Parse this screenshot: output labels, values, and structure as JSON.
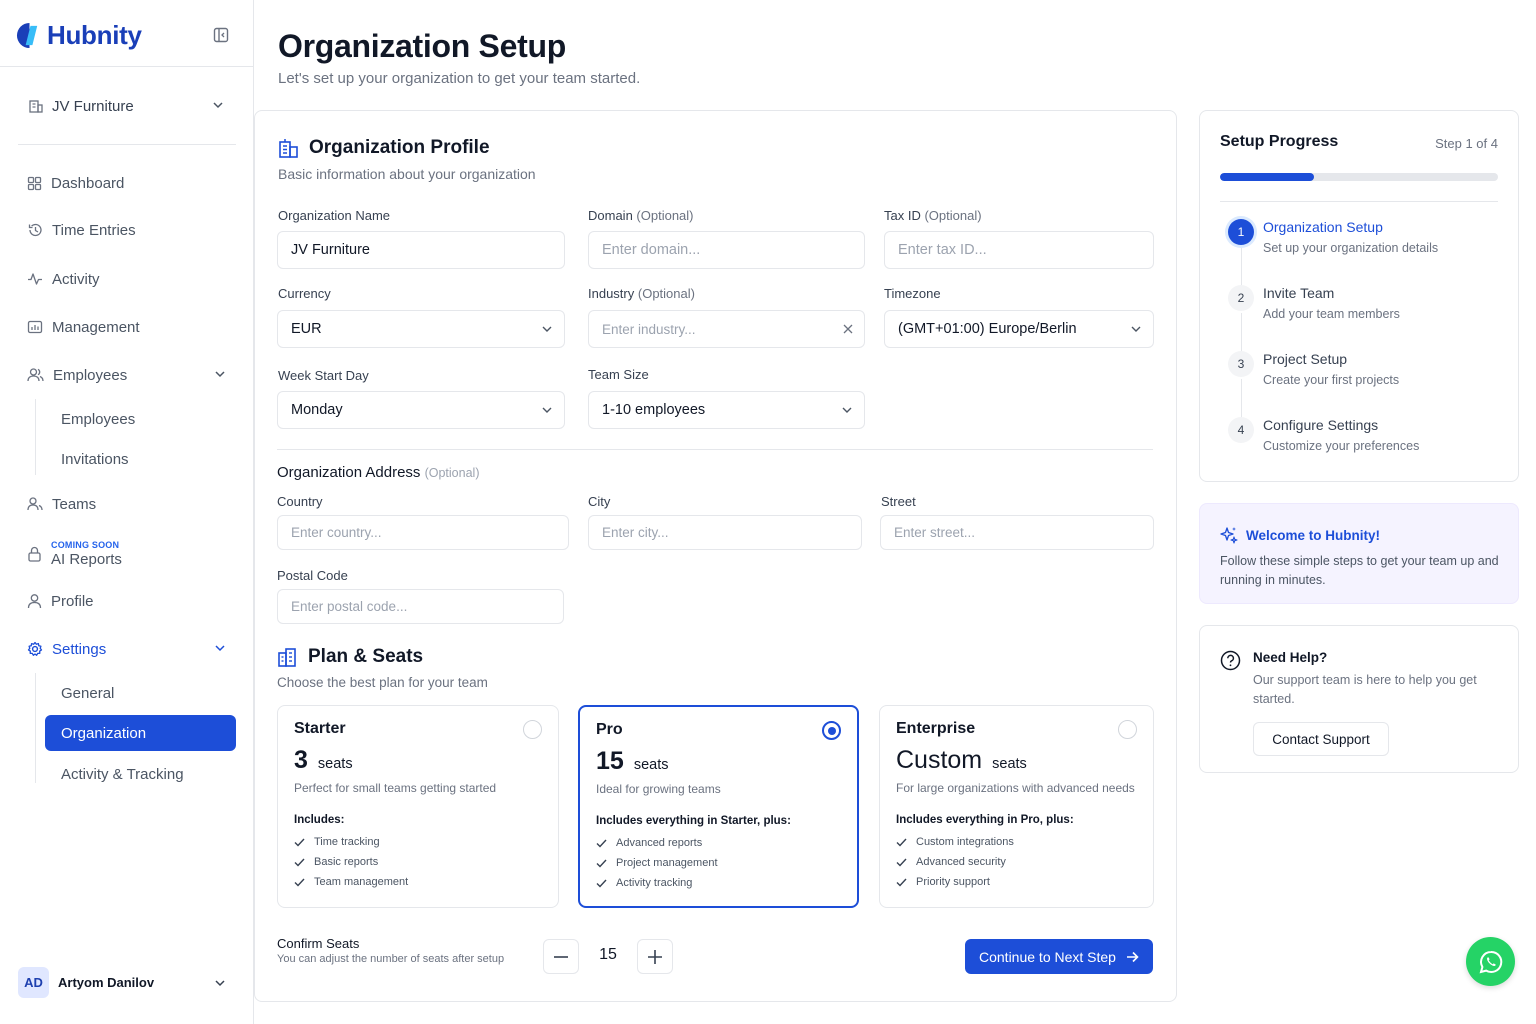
{
  "colors": {
    "primary": "#1d4ed8",
    "whatsapp": "#25d366"
  },
  "brand": {
    "name": "Hubnity",
    "logo_icon": "hubnity-logo-icon"
  },
  "sidebar": {
    "org_switcher": "JV Furniture",
    "items": {
      "dashboard": "Dashboard",
      "time_entries": "Time Entries",
      "activity": "Activity",
      "management": "Management",
      "employees": "Employees",
      "teams": "Teams",
      "ai_reports_badge": "COMING SOON",
      "ai_reports": "AI Reports",
      "profile": "Profile",
      "settings": "Settings"
    },
    "employees_sub": {
      "employees": "Employees",
      "invitations": "Invitations"
    },
    "settings_sub": {
      "general": "General",
      "organization": "Organization",
      "activity_tracking": "Activity & Tracking"
    },
    "user": {
      "initials": "AD",
      "name": "Artyom Danilov"
    }
  },
  "header": {
    "title": "Organization Setup",
    "subtitle": "Let's set up your organization to get your team started."
  },
  "profile": {
    "title": "Organization Profile",
    "subtitle": "Basic information about your organization",
    "org_name_label": "Organization Name",
    "org_name_value": "JV Furniture",
    "domain_label": "Domain",
    "optional": "(Optional)",
    "domain_placeholder": "Enter domain...",
    "tax_label": "Tax ID",
    "tax_placeholder": "Enter tax ID...",
    "currency_label": "Currency",
    "currency_value": "EUR",
    "industry_label": "Industry",
    "industry_placeholder": "Enter industry...",
    "timezone_label": "Timezone",
    "timezone_value": "(GMT+01:00) Europe/Berlin",
    "week_label": "Week Start Day",
    "week_value": "Monday",
    "team_size_label": "Team Size",
    "team_size_value": "1-10 employees"
  },
  "address": {
    "title": "Organization Address",
    "optional": "(Optional)",
    "country_label": "Country",
    "country_placeholder": "Enter country...",
    "city_label": "City",
    "city_placeholder": "Enter city...",
    "street_label": "Street",
    "street_placeholder": "Enter street...",
    "postal_label": "Postal Code",
    "postal_placeholder": "Enter postal code..."
  },
  "plans": {
    "title": "Plan & Seats",
    "subtitle": "Choose the best plan for your team",
    "seats_word": "seats",
    "selected": "Pro",
    "items": [
      {
        "name": "Starter",
        "seats": "3",
        "desc": "Perfect for small teams getting started",
        "includes": "Includes:",
        "features": [
          "Time tracking",
          "Basic reports",
          "Team management"
        ]
      },
      {
        "name": "Pro",
        "seats": "15",
        "desc": "Ideal for growing teams",
        "includes": "Includes everything in Starter, plus:",
        "features": [
          "Advanced reports",
          "Project management",
          "Activity tracking"
        ]
      },
      {
        "name": "Enterprise",
        "seats": "Custom",
        "desc": "For large organizations with advanced needs",
        "includes": "Includes everything in Pro, plus:",
        "features": [
          "Custom integrations",
          "Advanced security",
          "Priority support"
        ]
      }
    ]
  },
  "confirm": {
    "label": "Confirm Seats",
    "sub": "You can adjust the number of seats after setup",
    "value": "15",
    "cta": "Continue to Next Step"
  },
  "progress": {
    "title": "Setup Progress",
    "step_text": "Step 1 of 4",
    "fraction": 0.25,
    "steps": [
      {
        "num": "1",
        "title": "Organization Setup",
        "desc": "Set up your organization details"
      },
      {
        "num": "2",
        "title": "Invite Team",
        "desc": "Add your team members"
      },
      {
        "num": "3",
        "title": "Project Setup",
        "desc": "Create your first projects"
      },
      {
        "num": "4",
        "title": "Configure Settings",
        "desc": "Customize your preferences"
      }
    ]
  },
  "welcome": {
    "title": "Welcome to Hubnity!",
    "text": "Follow these simple steps to get your team up and running in minutes."
  },
  "help": {
    "title": "Need Help?",
    "text": "Our support team is here to help you get started.",
    "button": "Contact Support"
  }
}
